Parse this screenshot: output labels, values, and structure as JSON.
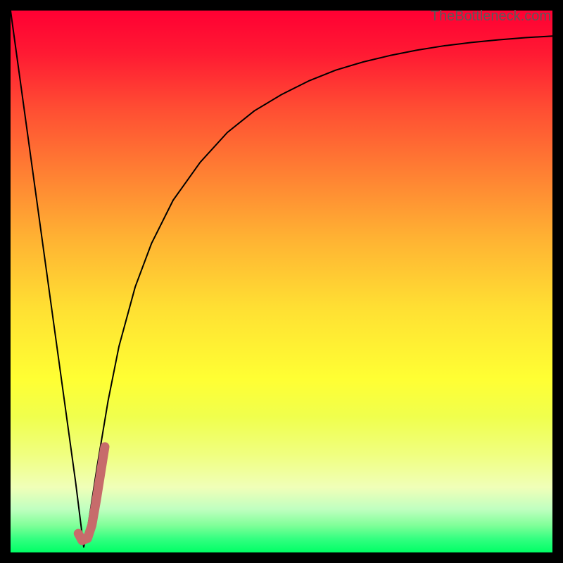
{
  "watermark": "TheBottleneck.com",
  "chart_data": {
    "type": "line",
    "title": "",
    "xlabel": "",
    "ylabel": "",
    "xlim": [
      0,
      100
    ],
    "ylim": [
      0,
      100
    ],
    "series": [
      {
        "name": "bottleneck-curve",
        "color": "#000000",
        "stroke_width": 2,
        "x": [
          0,
          2,
          4,
          6,
          8,
          10,
          12,
          13,
          13.5,
          14,
          16,
          18,
          20,
          23,
          26,
          30,
          35,
          40,
          45,
          50,
          55,
          60,
          65,
          70,
          75,
          80,
          85,
          90,
          95,
          100
        ],
        "y": [
          100,
          85.5,
          71,
          56.5,
          42,
          27.5,
          13,
          5,
          1,
          3,
          16,
          28,
          38,
          49,
          57,
          65,
          72,
          77.5,
          81.5,
          84.5,
          87,
          89,
          90.5,
          91.7,
          92.7,
          93.5,
          94.1,
          94.6,
          95,
          95.3
        ]
      },
      {
        "name": "highlight-segment",
        "color": "#c76b6b",
        "stroke_width": 13,
        "x": [
          12.5,
          13.2,
          14.2,
          15.0,
          15.8,
          16.6,
          17.4
        ],
        "y": [
          3.5,
          2.2,
          2.6,
          5.0,
          9.5,
          14.5,
          19.5
        ]
      }
    ]
  },
  "layout": {
    "canvas_size": 800,
    "border": 15,
    "plot_size": 770
  }
}
